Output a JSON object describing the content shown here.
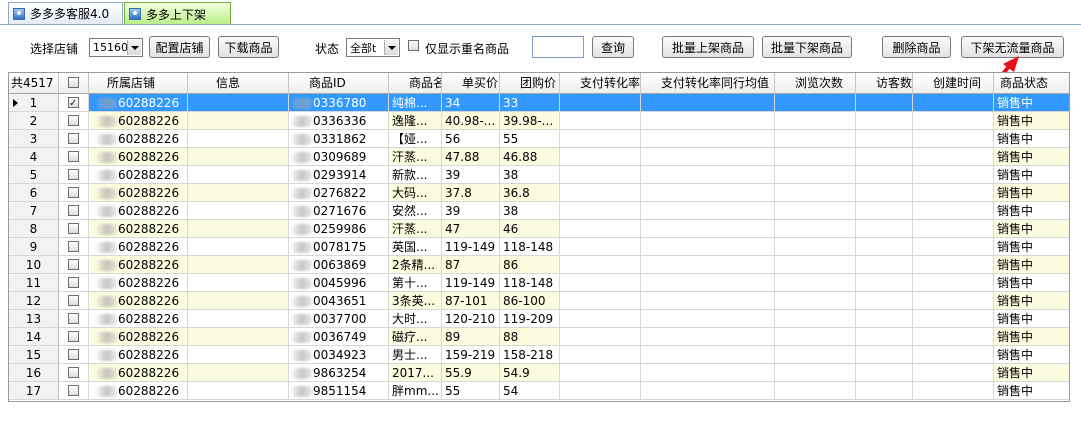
{
  "tabs": [
    {
      "label": "多多多客服4.0",
      "active": false
    },
    {
      "label": "多多上下架",
      "active": true
    }
  ],
  "toolbar": {
    "shop_label": "选择店铺",
    "shop_value": "15160",
    "config_shop": "配置店铺",
    "download": "下载商品",
    "status_label": "状态",
    "status_value": "全部t",
    "only_dup_label": "仅显示重名商品",
    "search_value": "",
    "query": "查询",
    "batch_on": "批量上架商品",
    "batch_off": "批量下架商品",
    "delete": "删除商品",
    "off_noflow": "下架无流量商品"
  },
  "grid": {
    "total": "共4517",
    "headers": [
      "所属店铺",
      "信息",
      "商品ID",
      "商品名",
      "单买价",
      "团购价",
      "支付转化率",
      "支付转化率同行均值",
      "浏览次数",
      "访客数",
      "创建时间",
      "商品状态"
    ],
    "rows": [
      {
        "n": "1",
        "shop": "60288226",
        "id": "0336780",
        "name": "纯棉...",
        "single": "34",
        "group": "33",
        "status": "销售中",
        "checked": true
      },
      {
        "n": "2",
        "shop": "60288226",
        "id": "0336336",
        "name": "逸隆...",
        "single": "40.98-...",
        "group": "39.98-...",
        "status": "销售中",
        "checked": false
      },
      {
        "n": "3",
        "shop": "60288226",
        "id": "0331862",
        "name": "【娅...",
        "single": "56",
        "group": "55",
        "status": "销售中",
        "checked": false
      },
      {
        "n": "4",
        "shop": "60288226",
        "id": "0309689",
        "name": "汗蒸...",
        "single": "47.88",
        "group": "46.88",
        "status": "销售中",
        "checked": false
      },
      {
        "n": "5",
        "shop": "60288226",
        "id": "0293914",
        "name": "新款...",
        "single": "39",
        "group": "38",
        "status": "销售中",
        "checked": false
      },
      {
        "n": "6",
        "shop": "60288226",
        "id": "0276822",
        "name": "大码...",
        "single": "37.8",
        "group": "36.8",
        "status": "销售中",
        "checked": false
      },
      {
        "n": "7",
        "shop": "60288226",
        "id": "0271676",
        "name": "安然...",
        "single": "39",
        "group": "38",
        "status": "销售中",
        "checked": false
      },
      {
        "n": "8",
        "shop": "60288226",
        "id": "0259986",
        "name": "汗蒸...",
        "single": "47",
        "group": "46",
        "status": "销售中",
        "checked": false
      },
      {
        "n": "9",
        "shop": "60288226",
        "id": "0078175",
        "name": "英国...",
        "single": "119-149",
        "group": "118-148",
        "status": "销售中",
        "checked": false
      },
      {
        "n": "10",
        "shop": "60288226",
        "id": "0063869",
        "name": "2条精...",
        "single": "87",
        "group": "86",
        "status": "销售中",
        "checked": false
      },
      {
        "n": "11",
        "shop": "60288226",
        "id": "0045996",
        "name": "第十...",
        "single": "119-149",
        "group": "118-148",
        "status": "销售中",
        "checked": false
      },
      {
        "n": "12",
        "shop": "60288226",
        "id": "0043651",
        "name": "3条英...",
        "single": "87-101",
        "group": "86-100",
        "status": "销售中",
        "checked": false
      },
      {
        "n": "13",
        "shop": "60288226",
        "id": "0037700",
        "name": "大时...",
        "single": "120-210",
        "group": "119-209",
        "status": "销售中",
        "checked": false
      },
      {
        "n": "14",
        "shop": "60288226",
        "id": "0036749",
        "name": "磁疗...",
        "single": "89",
        "group": "88",
        "status": "销售中",
        "checked": false
      },
      {
        "n": "15",
        "shop": "60288226",
        "id": "0034923",
        "name": "男士...",
        "single": "159-219",
        "group": "158-218",
        "status": "销售中",
        "checked": false
      },
      {
        "n": "16",
        "shop": "60288226",
        "id": "9863254",
        "name": "2017...",
        "single": "55.9",
        "group": "54.9",
        "status": "销售中",
        "checked": false
      },
      {
        "n": "17",
        "shop": "60288226",
        "id": "9851154",
        "name": "胖mm...",
        "single": "55",
        "group": "54",
        "status": "销售中",
        "checked": false
      }
    ]
  },
  "colors": {
    "selected": "#3399ff",
    "alt_row": "#fcfce0",
    "arrow": "#e8101a"
  }
}
